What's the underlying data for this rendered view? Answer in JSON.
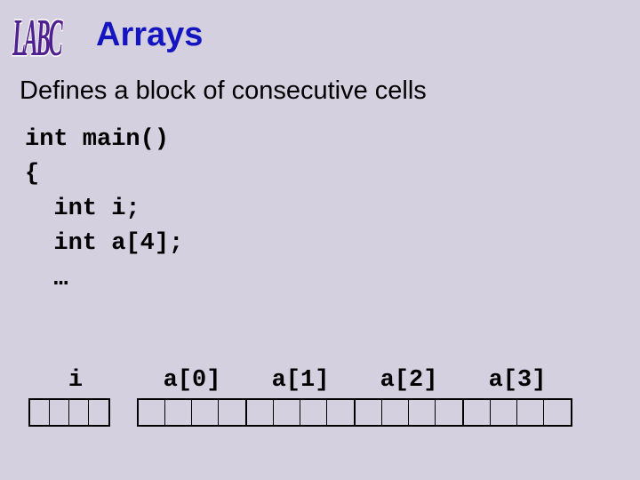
{
  "logo": "LABC",
  "title": "Arrays",
  "subtitle": "Defines a block of consecutive cells",
  "code": {
    "l1": "int main()",
    "l2": "{",
    "l3": "  int i;",
    "l4": "  int a[4];",
    "l5": "  …"
  },
  "cells": {
    "i": "i",
    "a0": "a[0]",
    "a1": "a[1]",
    "a2": "a[2]",
    "a3": "a[3]"
  }
}
